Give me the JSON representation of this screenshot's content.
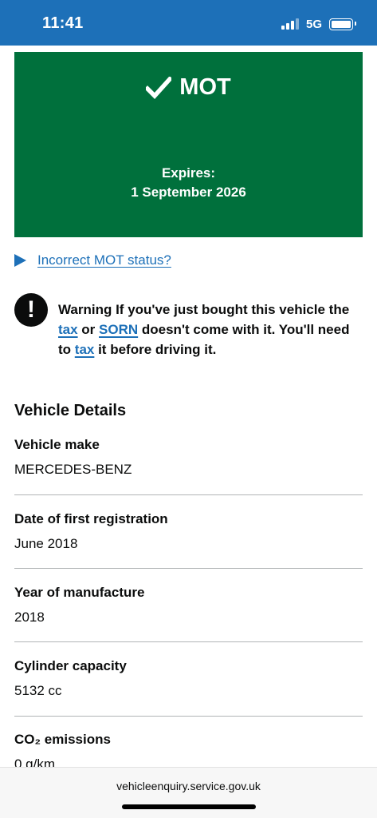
{
  "status_bar": {
    "time": "11:41",
    "network": "5G",
    "signal_bars_active": 3,
    "signal_bars_total": 4,
    "battery_level": 1.0
  },
  "mot": {
    "title": "MOT",
    "expires_label": "Expires:",
    "expires_date": "1 September 2026",
    "status_color": "#00703c",
    "icon": "check-icon"
  },
  "details_toggle": {
    "label": "Incorrect MOT status?",
    "icon": "triangle-right-icon"
  },
  "warning": {
    "icon_text": "!",
    "part1": "Warning If you've just bought this vehicle the ",
    "link1": "tax",
    "part2": " or ",
    "link2": "SORN",
    "part3": " doesn't come with it. You'll need to ",
    "link3": "tax",
    "part4": " it before driving it."
  },
  "vehicle_details": {
    "heading": "Vehicle Details",
    "rows": [
      {
        "key": "Vehicle make",
        "value": "MERCEDES-BENZ"
      },
      {
        "key": "Date of first registration",
        "value": "June 2018"
      },
      {
        "key": "Year of manufacture",
        "value": "2018"
      },
      {
        "key": "Cylinder capacity",
        "value": "5132 cc"
      },
      {
        "key": "CO₂ emissions",
        "value": "0 g/km"
      }
    ]
  },
  "browser": {
    "url": "vehicleenquiry.service.gov.uk"
  },
  "colors": {
    "header_blue": "#1d70b8",
    "link_blue": "#1d70b8",
    "mot_green": "#00703c",
    "text": "#0b0c0c",
    "divider": "#b1b4b6"
  }
}
